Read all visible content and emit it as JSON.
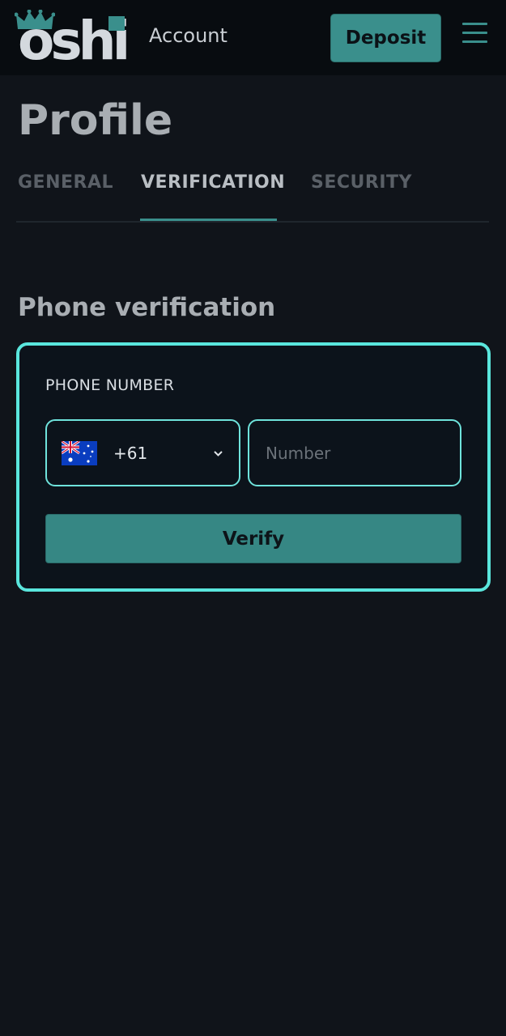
{
  "header": {
    "logo_text": "oshi",
    "title": "Account",
    "deposit_label": "Deposit",
    "menu_icon": "hamburger-menu-icon"
  },
  "page": {
    "title": "Profile"
  },
  "tabs": [
    {
      "label": "GENERAL",
      "active": false
    },
    {
      "label": "VERIFICATION",
      "active": true
    },
    {
      "label": "SECURITY",
      "active": false
    }
  ],
  "phone_verification": {
    "title": "Phone verification",
    "field_label": "PHONE NUMBER",
    "country": {
      "flag_icon": "australia-flag-icon",
      "code": "+61"
    },
    "number_placeholder": "Number",
    "number_value": "",
    "verify_label": "Verify"
  },
  "colors": {
    "accent": "#3a8f8c",
    "highlight_border": "#5ae6dd",
    "background": "#10141a",
    "header_background": "#080c10"
  }
}
